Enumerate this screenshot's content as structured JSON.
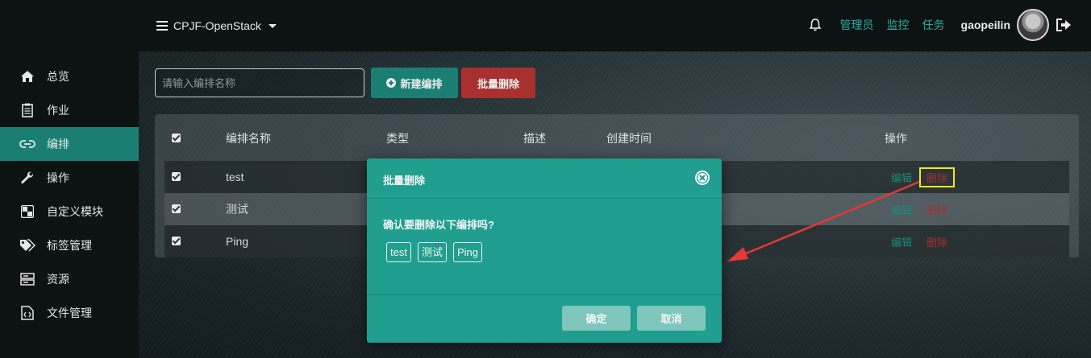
{
  "header": {
    "project": "CPJF-OpenStack",
    "links": [
      "管理员",
      "监控",
      "任务"
    ],
    "username": "gaopeilin",
    "icons": [
      "list-icon",
      "chevron-down-icon",
      "bell-icon",
      "avatar",
      "logout-icon"
    ]
  },
  "sidebar": {
    "items": [
      {
        "label": "总览",
        "icon": "home-icon",
        "active": false
      },
      {
        "label": "作业",
        "icon": "clipboard-icon",
        "active": false
      },
      {
        "label": "编排",
        "icon": "link-icon",
        "active": true
      },
      {
        "label": "操作",
        "icon": "wrench-icon",
        "active": false
      },
      {
        "label": "自定义模块",
        "icon": "module-icon",
        "active": false
      },
      {
        "label": "标签管理",
        "icon": "tags-icon",
        "active": false
      },
      {
        "label": "资源",
        "icon": "server-icon",
        "active": false
      },
      {
        "label": "文件管理",
        "icon": "file-code-icon",
        "active": false
      }
    ]
  },
  "toolbar": {
    "search_placeholder": "请输入编排名称",
    "new_label": "新建编排",
    "batch_delete_label": "批量删除"
  },
  "table": {
    "headers": {
      "name": "编排名称",
      "type": "类型",
      "desc": "描述",
      "created": "创建时间",
      "actions": "操作"
    },
    "rows": [
      {
        "name": "test",
        "checked": true,
        "edit": "编辑",
        "delete": "删除"
      },
      {
        "name": "测试",
        "checked": true,
        "edit": "编辑",
        "delete": "删除"
      },
      {
        "name": "Ping",
        "checked": true,
        "edit": "编辑",
        "delete": "删除"
      }
    ]
  },
  "modal": {
    "title": "批量删除",
    "message": "确认要删除以下编排吗?",
    "tags": [
      "test",
      "测试",
      "Ping"
    ],
    "ok_label": "确定",
    "cancel_label": "取消"
  },
  "colors": {
    "accent": "#1a7f72",
    "modal_bg": "#209e8f",
    "danger": "#a8302e",
    "highlight": "#f2ea1a",
    "arrow": "#e53935"
  }
}
